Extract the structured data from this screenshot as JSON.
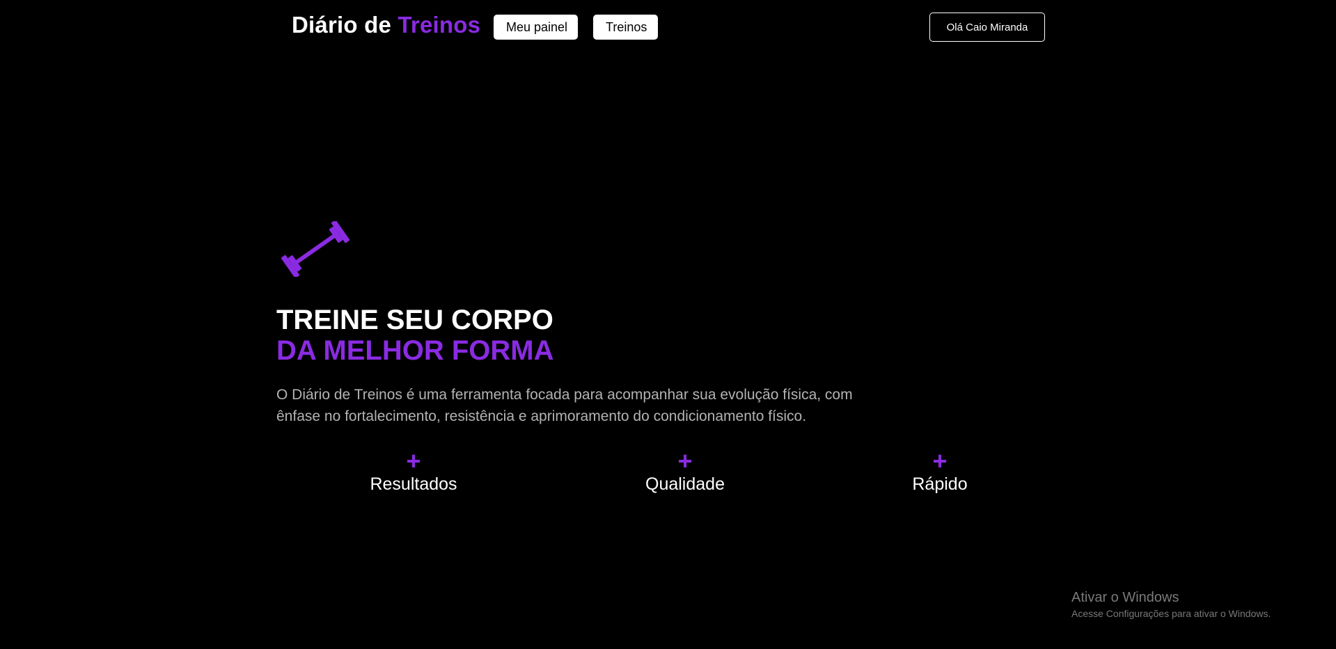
{
  "header": {
    "logo": {
      "prefix": "Diário de",
      "accent": "Treinos"
    },
    "nav": [
      {
        "label": "Meu painel"
      },
      {
        "label": "Treinos"
      }
    ],
    "user_button": "Olá Caio Miranda"
  },
  "hero": {
    "icon": "dumbbell-icon",
    "headline_line1": "TREINE SEU CORPO",
    "headline_line2": "DA MELHOR FORMA",
    "description": "O Diário de Treinos é uma ferramenta focada para acompanhar sua evolução física, com ênfase no fortalecimento, resistência e aprimoramento do condicionamento físico."
  },
  "features": [
    {
      "icon": "plus-icon",
      "symbol": "+",
      "label": "Resultados"
    },
    {
      "icon": "plus-icon",
      "symbol": "+",
      "label": "Qualidade"
    },
    {
      "icon": "plus-icon",
      "symbol": "+",
      "label": "Rápido"
    }
  ],
  "watermark": {
    "title": "Ativar o Windows",
    "subtitle": "Acesse Configurações para ativar o Windows."
  },
  "colors": {
    "background": "#000000",
    "accent": "#8a2be2",
    "text": "#ffffff",
    "muted_text": "#b3b3b3"
  }
}
